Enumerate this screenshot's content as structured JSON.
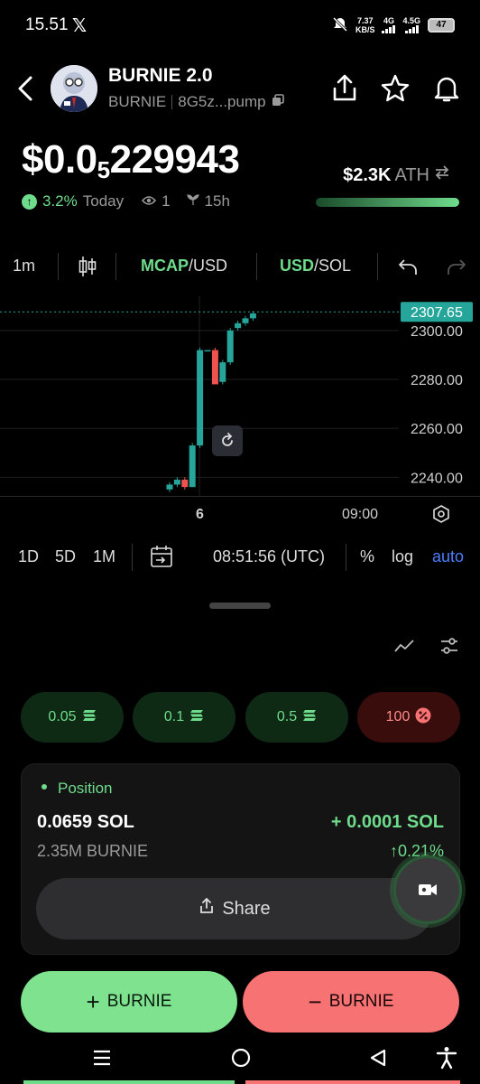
{
  "status": {
    "time": "15.51",
    "net_speed_top": "7.37",
    "net_speed_bottom": "KB/S",
    "net1": "4G",
    "net2": "4.5G",
    "battery": "47"
  },
  "header": {
    "name": "BURNIE 2.0",
    "symbol": "BURNIE",
    "address": "8G5z...pump"
  },
  "price": {
    "main": "$0.0",
    "sub": "5",
    "rest": "229943"
  },
  "stats": {
    "change": "3.2%",
    "change_label": "Today",
    "watchers": "1",
    "age": "15h",
    "ath_value": "$2.3K",
    "ath_label": "ATH",
    "ath_progress": 1.0
  },
  "toolbar": {
    "interval": "1m",
    "mcap": "MCAP",
    "mcap_unit": "/USD",
    "usd": "USD",
    "usd_unit": "/SOL"
  },
  "chart_data": {
    "type": "candlestick",
    "y_ticks": [
      "2300.00",
      "2280.00",
      "2260.00",
      "2240.00"
    ],
    "y_tick_values": [
      2300,
      2280,
      2260,
      2240
    ],
    "last_price": "2307.65",
    "last_price_value": 2307.65,
    "ylim": [
      2232,
      2314
    ],
    "x_ticks": [
      "6",
      "09:00"
    ],
    "candles": [
      {
        "o": 2235,
        "c": 2237,
        "h": 2238,
        "l": 2234
      },
      {
        "o": 2237,
        "c": 2239,
        "h": 2240,
        "l": 2236
      },
      {
        "o": 2239,
        "c": 2236,
        "h": 2240,
        "l": 2235
      },
      {
        "o": 2236,
        "c": 2253,
        "h": 2254,
        "l": 2236
      },
      {
        "o": 2253,
        "c": 2292,
        "h": 2293,
        "l": 2252
      },
      {
        "o": 2292,
        "c": 2292,
        "h": 2292,
        "l": 2292
      },
      {
        "o": 2292,
        "c": 2278,
        "h": 2293,
        "l": 2278
      },
      {
        "o": 2279,
        "c": 2287,
        "h": 2288,
        "l": 2278
      },
      {
        "o": 2287,
        "c": 2300,
        "h": 2301,
        "l": 2286
      },
      {
        "o": 2301,
        "c": 2303,
        "h": 2304,
        "l": 2300
      },
      {
        "o": 2303,
        "c": 2305,
        "h": 2306,
        "l": 2302
      },
      {
        "o": 2305,
        "c": 2307,
        "h": 2308,
        "l": 2304
      }
    ]
  },
  "range": {
    "r1": "1D",
    "r2": "5D",
    "r3": "1M",
    "time": "08:51:56 (UTC)",
    "pct": "%",
    "log": "log",
    "auto": "auto"
  },
  "quick": [
    {
      "label": "0.05"
    },
    {
      "label": "0.1"
    },
    {
      "label": "0.5"
    },
    {
      "label": "100"
    }
  ],
  "position": {
    "title": "Position",
    "sol": "0.0659 SOL",
    "pnl_sol": "+ 0.0001 SOL",
    "tokens": "2.35M BURNIE",
    "pnl_pct": "0.21%",
    "share": "Share"
  },
  "actions": {
    "buy": "BURNIE",
    "sell": "BURNIE"
  },
  "colors": {
    "up": "#26a69a",
    "down": "#ef5350",
    "accent": "#6fdc8c",
    "sell": "#f77272"
  }
}
